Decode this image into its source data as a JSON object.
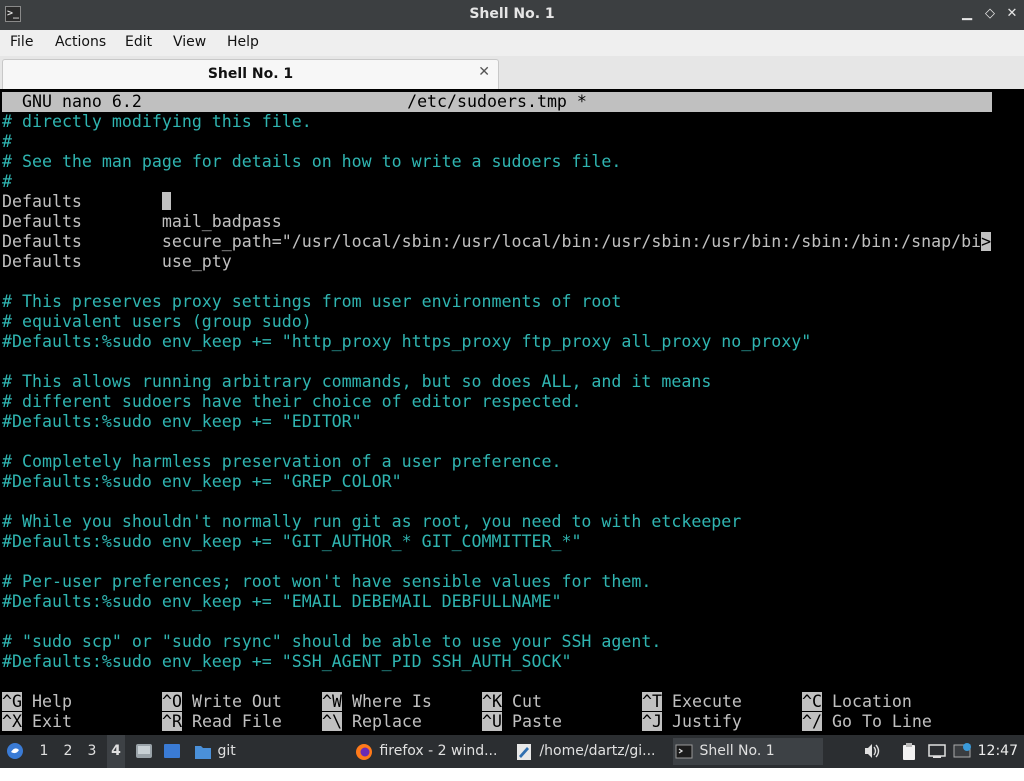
{
  "window": {
    "title": "Shell No. 1",
    "controls": {
      "minimize": "▁",
      "maximize": "◇",
      "close": "✕"
    }
  },
  "menubar": {
    "items": [
      "File",
      "Actions",
      "Edit",
      "View",
      "Help"
    ]
  },
  "tabs": [
    {
      "label": "Shell No. 1",
      "close": "✕"
    }
  ],
  "nano": {
    "version": "GNU nano 6.2",
    "filename": "/etc/sudoers.tmp *",
    "lines": [
      {
        "text": "# directly modifying this file.",
        "type": "comment"
      },
      {
        "text": "#",
        "type": "comment"
      },
      {
        "text": "# See the man page for details on how to write a sudoers file.",
        "type": "comment"
      },
      {
        "text": "#",
        "type": "comment"
      },
      {
        "text": "Defaults        ",
        "type": "code",
        "cursor": true
      },
      {
        "text": "Defaults        mail_badpass",
        "type": "code"
      },
      {
        "text": "Defaults        secure_path=\"/usr/local/sbin:/usr/local/bin:/usr/sbin:/usr/bin:/sbin:/bin:/snap/bi",
        "type": "code",
        "overflow": ">"
      },
      {
        "text": "Defaults        use_pty",
        "type": "code"
      },
      {
        "text": "",
        "type": "code"
      },
      {
        "text": "# This preserves proxy settings from user environments of root",
        "type": "comment"
      },
      {
        "text": "# equivalent users (group sudo)",
        "type": "comment"
      },
      {
        "text": "#Defaults:%sudo env_keep += \"http_proxy https_proxy ftp_proxy all_proxy no_proxy\"",
        "type": "comment"
      },
      {
        "text": "",
        "type": "code"
      },
      {
        "text": "# This allows running arbitrary commands, but so does ALL, and it means",
        "type": "comment"
      },
      {
        "text": "# different sudoers have their choice of editor respected.",
        "type": "comment"
      },
      {
        "text": "#Defaults:%sudo env_keep += \"EDITOR\"",
        "type": "comment"
      },
      {
        "text": "",
        "type": "code"
      },
      {
        "text": "# Completely harmless preservation of a user preference.",
        "type": "comment"
      },
      {
        "text": "#Defaults:%sudo env_keep += \"GREP_COLOR\"",
        "type": "comment"
      },
      {
        "text": "",
        "type": "code"
      },
      {
        "text": "# While you shouldn't normally run git as root, you need to with etckeeper",
        "type": "comment"
      },
      {
        "text": "#Defaults:%sudo env_keep += \"GIT_AUTHOR_* GIT_COMMITTER_*\"",
        "type": "comment"
      },
      {
        "text": "",
        "type": "code"
      },
      {
        "text": "# Per-user preferences; root won't have sensible values for them.",
        "type": "comment"
      },
      {
        "text": "#Defaults:%sudo env_keep += \"EMAIL DEBEMAIL DEBFULLNAME\"",
        "type": "comment"
      },
      {
        "text": "",
        "type": "code"
      },
      {
        "text": "# \"sudo scp\" or \"sudo rsync\" should be able to use your SSH agent.",
        "type": "comment"
      },
      {
        "text": "#Defaults:%sudo env_keep += \"SSH_AGENT_PID SSH_AUTH_SOCK\"",
        "type": "comment"
      }
    ],
    "shortcuts": [
      {
        "key": "^G",
        "label": "Help"
      },
      {
        "key": "^O",
        "label": "Write Out"
      },
      {
        "key": "^W",
        "label": "Where Is"
      },
      {
        "key": "^K",
        "label": "Cut"
      },
      {
        "key": "^T",
        "label": "Execute"
      },
      {
        "key": "^C",
        "label": "Location"
      },
      {
        "key": "^X",
        "label": "Exit"
      },
      {
        "key": "^R",
        "label": "Read File"
      },
      {
        "key": "^\\",
        "label": "Replace"
      },
      {
        "key": "^U",
        "label": "Paste"
      },
      {
        "key": "^J",
        "label": "Justify"
      },
      {
        "key": "^/",
        "label": "Go To Line"
      }
    ]
  },
  "taskbar": {
    "workspaces": [
      "1",
      "2",
      "3",
      "4"
    ],
    "active_workspace": "4",
    "tasks": [
      {
        "label": "git",
        "icon": "folder-icon"
      },
      {
        "label": "firefox - 2 wind...",
        "icon": "firefox-icon"
      },
      {
        "label": "/home/dartz/gi...",
        "icon": "text-editor-icon"
      },
      {
        "label": "Shell No. 1",
        "icon": "terminal-icon",
        "active": true
      }
    ],
    "clock": "12:47"
  },
  "colors": {
    "terminal_bg": "#000000",
    "comment": "#2fb5b1",
    "text": "#c0c0c0",
    "header_bg": "#c0c0c0",
    "taskbar_bg": "#2b2e31"
  }
}
